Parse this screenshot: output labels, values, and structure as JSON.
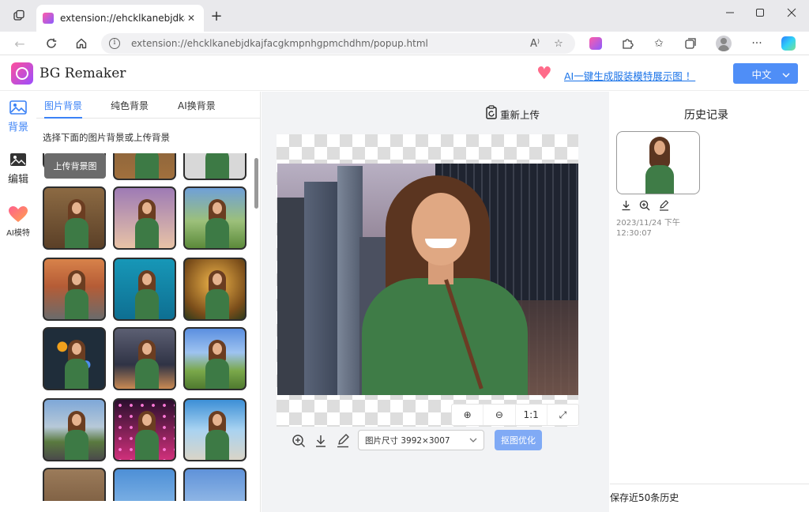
{
  "browser": {
    "tab_title": "extension://ehcklkanebjdkajfacgkmpnhgpmchdhm",
    "tab_close": "✕",
    "new_tab": "+",
    "url": "extension://ehcklkanebjdkajfacgkmpnhgpmchdhm/popup.html",
    "read_aloud": "A⁾"
  },
  "app": {
    "title": "BG Remaker",
    "promo_link": "AI一键生成服装模特展示图 ！",
    "language": "中文"
  },
  "rail": {
    "items": [
      {
        "label": "背景",
        "icon": "image-icon",
        "active": true
      },
      {
        "label": "编辑",
        "icon": "edit-image-icon",
        "active": false
      },
      {
        "label": "AI模特",
        "icon": "heart-icon",
        "active": false
      }
    ]
  },
  "panel": {
    "tabs": [
      "图片背景",
      "纯色背景",
      "AI换背景"
    ],
    "hint": "选择下面的图片背景或上传背景",
    "upload_label": "上传背景图"
  },
  "canvas": {
    "reupload_label": "重新上传",
    "zoom_in": "⊕",
    "zoom_out": "⊖",
    "actual_size": "1:1",
    "fullscreen": "⤢",
    "image_size": "图片尺寸 3992×3007",
    "optimize_label": "抠图优化"
  },
  "history": {
    "title": "历史记录",
    "timestamp": "2023/11/24 下午12:30:07",
    "footer": "保存近50条历史"
  },
  "colors": {
    "accent": "#3b82f6",
    "button_blue": "#4f8ef7",
    "optimize_button": "#80aaf5",
    "brand_pink": "#ff4f9a"
  }
}
